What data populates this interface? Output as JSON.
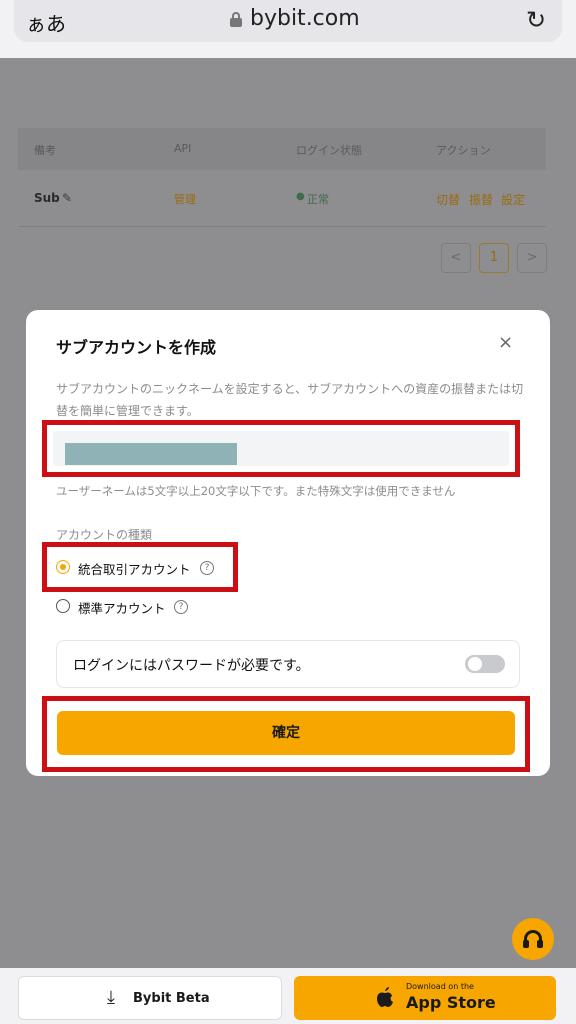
{
  "browser": {
    "text_size_label": "ぁあ",
    "domain": "bybit.com",
    "reload_glyph": "↻",
    "icons": [
      "lock-icon",
      "reload-icon"
    ]
  },
  "table": {
    "headers": [
      "備考",
      "API",
      "ログイン状態",
      "アクション"
    ],
    "row": {
      "note": "Sub",
      "api": "管理",
      "login_status": "正常",
      "actions": [
        "切替",
        "振替",
        "設定"
      ]
    },
    "pagination": {
      "prev": "<",
      "current": "1",
      "next": ">"
    }
  },
  "modal": {
    "title": "サブアカウントを作成",
    "close_glyph": "×",
    "description": "サブアカウントのニックネームを設定すると、サブアカウントへの資産の振替または切替を簡単に管理できます。",
    "username_hint": "ユーザーネームは5文字以上20文字以下です。また特殊文字は使用できません",
    "account_type_label": "アカウントの種類",
    "options": [
      {
        "label": "統合取引アカウント",
        "selected": true
      },
      {
        "label": "標準アカウント",
        "selected": false
      }
    ],
    "help_glyph": "?",
    "password_toggle_label": "ログインにはパスワードが必要です。",
    "password_toggle_on": false,
    "confirm_label": "確定"
  },
  "bottom": {
    "beta_label": "Bybit Beta",
    "store_small": "Download on the",
    "store_big": "App Store"
  },
  "colors": {
    "accent": "#f7a600",
    "highlight_box": "#cc0f14",
    "overlay": "#8e8e90"
  }
}
